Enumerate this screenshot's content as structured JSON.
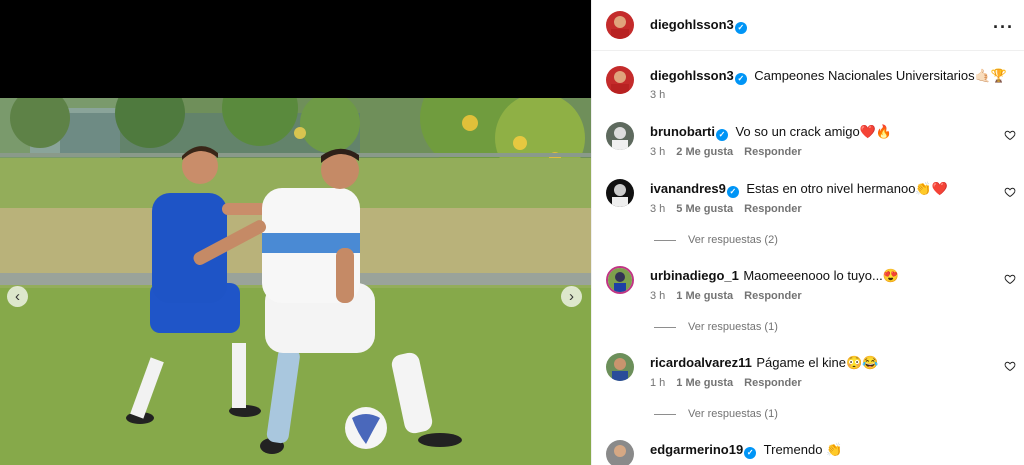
{
  "post": {
    "author": "diegohlsson3",
    "caption": "Campeones Nacionales Universitarios🤙🏻🏆",
    "time": "3 h"
  },
  "icons": {
    "prev": "chevron-left-icon",
    "next": "chevron-right-icon",
    "more": "more-options-icon",
    "verified": "verified-badge-icon",
    "like": "heart-icon"
  },
  "colors": {
    "verified": "#0095f6",
    "secondary_text": "#737373"
  },
  "comments": [
    {
      "user": "brunobarti",
      "verified": true,
      "text": "Vo so un crack amigo❤️🔥",
      "time": "3 h",
      "likes": "2 Me gusta",
      "reply": "Responder"
    },
    {
      "user": "ivanandres9",
      "verified": true,
      "text": "Estas en otro nivel hermanoo👏❤️",
      "time": "3 h",
      "likes": "5 Me gusta",
      "reply": "Responder",
      "view_replies": "Ver respuestas (2)"
    },
    {
      "user": "urbinadiego_1",
      "verified": false,
      "text": "Maomeeenooo lo tuyo...😍",
      "time": "3 h",
      "likes": "1 Me gusta",
      "reply": "Responder",
      "view_replies": "Ver respuestas (1)"
    },
    {
      "user": "ricardoalvarez11",
      "verified": false,
      "text": "Págame el kine😳😂",
      "time": "1 h",
      "likes": "1 Me gusta",
      "reply": "Responder",
      "view_replies": "Ver respuestas (1)"
    },
    {
      "user": "edgarmerino19",
      "verified": true,
      "text": "Tremendo 👏"
    }
  ]
}
